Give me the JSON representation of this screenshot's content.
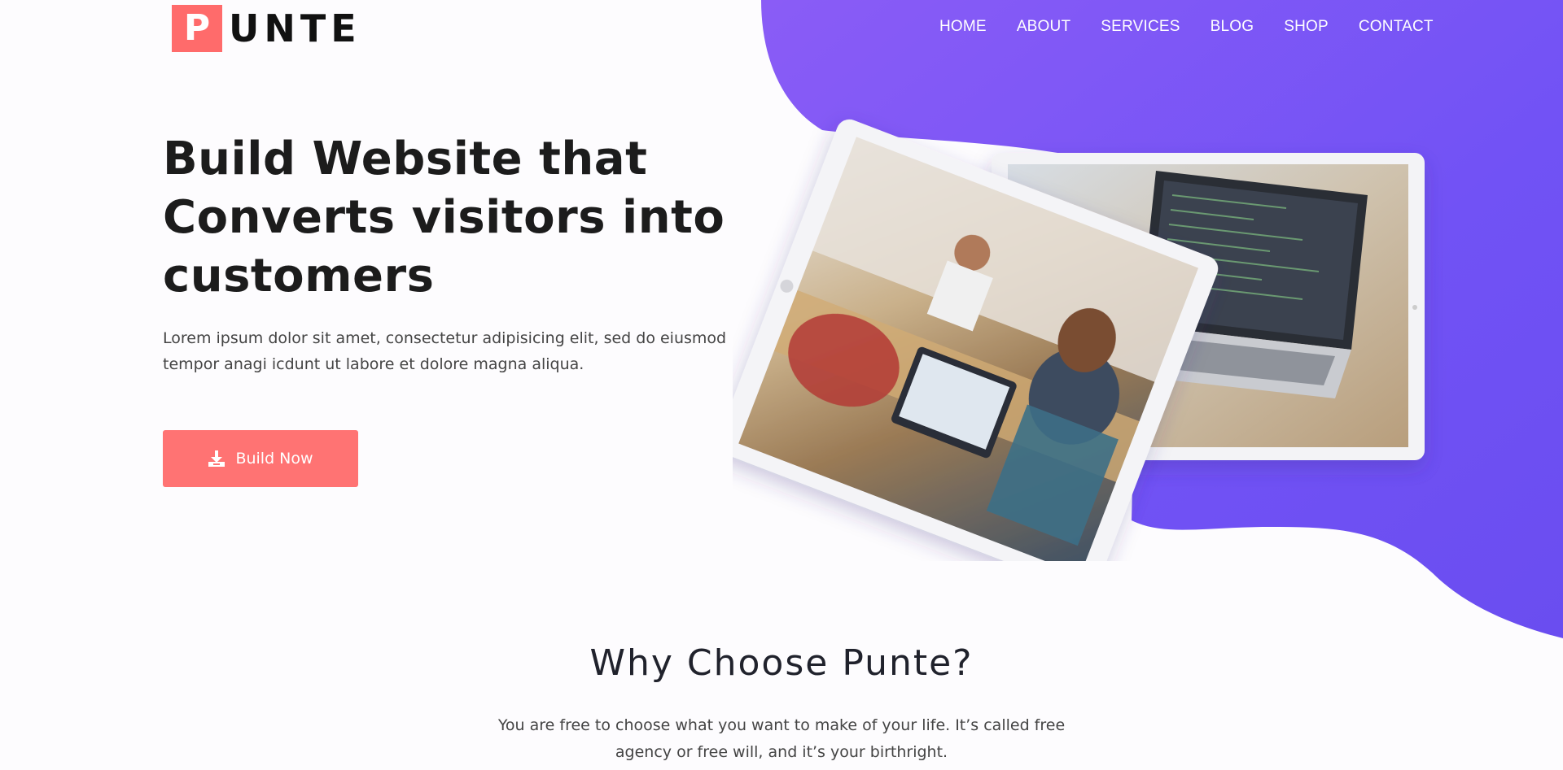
{
  "brand": {
    "logo_letter": "P",
    "logo_rest": "UNTE",
    "accent_color": "#ff6b6b",
    "gradient_colors": [
      "#8a5cf6",
      "#6366f1"
    ]
  },
  "nav": {
    "items": [
      "HOME",
      "ABOUT",
      "SERVICES",
      "BLOG",
      "SHOP",
      "CONTACT"
    ]
  },
  "hero": {
    "title_lines": [
      "Build Website that",
      "Converts visitors into",
      "customers"
    ],
    "description": "Lorem ipsum dolor sit amet, consectetur adipisicing elit, sed do eiusmod tempor anagi icdunt ut labore et dolore magna aliqua.",
    "button_label": "Build Now",
    "button_icon": "download-icon",
    "illustration": "tablet-and-laptop-office-photo"
  },
  "why": {
    "title": "Why Choose Punte?",
    "description": "You are free to choose what you want to make of your life. It’s called free agency or free will, and it’s your birthright."
  }
}
